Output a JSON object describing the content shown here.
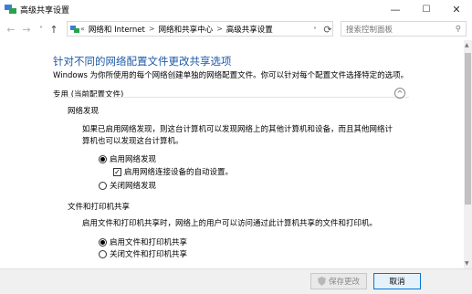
{
  "window": {
    "title": "高级共享设置",
    "minimize": "—",
    "maximize": "☐",
    "close": "✕"
  },
  "nav": {
    "back": "←",
    "forward": "→",
    "recent": "˅",
    "up": "↑",
    "overflow": "«",
    "breadcrumbs": [
      "网络和 Internet",
      "网络和共享中心",
      "高级共享设置"
    ],
    "separator": ">",
    "dropdown": "˅",
    "refresh": "⟳",
    "search_placeholder": "搜索控制面板",
    "search_icon": "⚲"
  },
  "main": {
    "heading": "针对不同的网络配置文件更改共享选项",
    "description": "Windows 为你所使用的每个网络创建单独的网络配置文件。你可以针对每个配置文件选择特定的选项。",
    "profile": {
      "label": "专用 (当前配置文件)",
      "collapse": "^"
    },
    "discovery": {
      "title": "网络发现",
      "desc": "如果已启用网络发现，则这台计算机可以发现网络上的其他计算机和设备，而且其他网络计算机也可以发现这台计算机。",
      "option_on": "启用网络发现",
      "auto_setup": "启用网络连接设备的自动设置。",
      "option_off": "关闭网络发现",
      "selected": "on",
      "auto_setup_checked": true
    },
    "file_sharing": {
      "title": "文件和打印机共享",
      "desc": "启用文件和打印机共享时，网络上的用户可以访问通过此计算机共享的文件和打印机。",
      "option_on": "启用文件和打印机共享",
      "option_off": "关闭文件和打印机共享",
      "selected": "on"
    }
  },
  "footer": {
    "save": "保存更改",
    "cancel": "取消"
  }
}
